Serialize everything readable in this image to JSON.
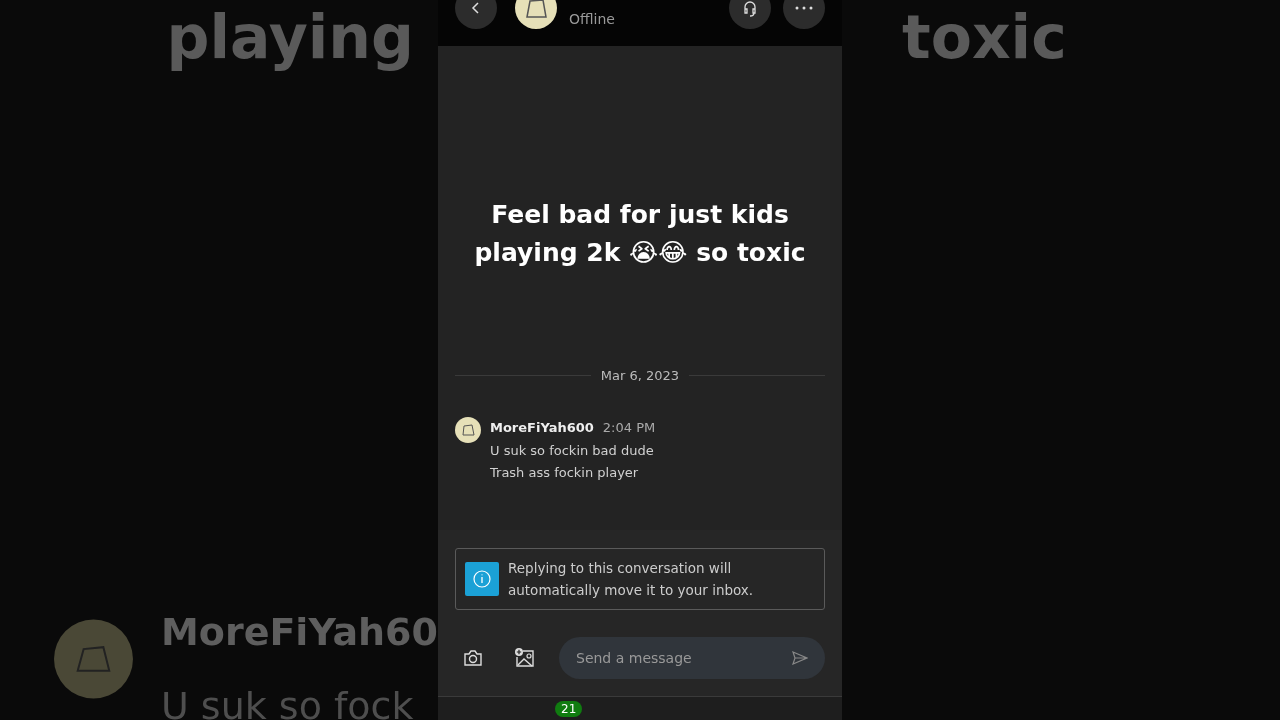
{
  "backdrop": {
    "top_left": "playing",
    "top_right": "toxic",
    "bottom_name": "MoreFiYah60",
    "bottom_text": "U suk so fock"
  },
  "header": {
    "status": "Offline"
  },
  "caption": "Feel bad for just kids playing 2k 😭😂 so toxic",
  "date": "Mar 6, 2023",
  "messages": [
    {
      "author": "MoreFiYah600",
      "time": "2:04 PM",
      "lines": [
        "U suk so fockin bad dude",
        "Trash ass fockin player"
      ]
    }
  ],
  "notice": "Replying to this conversation will automatically move it to your inbox.",
  "composer": {
    "placeholder": "Send a message"
  },
  "nav": {
    "badge": "21"
  }
}
